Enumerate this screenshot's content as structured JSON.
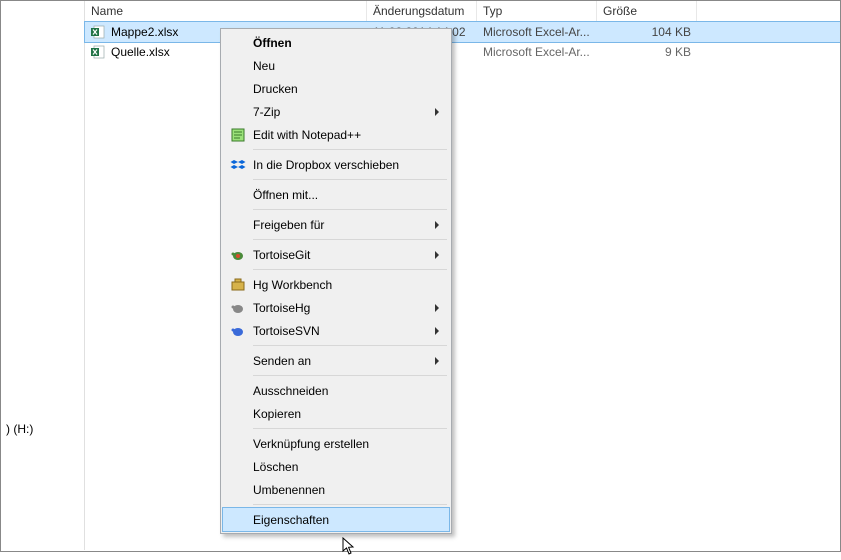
{
  "tree": {
    "drive_label": ") (H:)"
  },
  "columns": {
    "name": "Name",
    "date": "Änderungsdatum",
    "type": "Typ",
    "size": "Größe"
  },
  "files": [
    {
      "name": "Mappe2.xlsx",
      "date": "11.02.2014 14:02",
      "type": "Microsoft Excel-Ar...",
      "size": "104 KB",
      "selected": true
    },
    {
      "name": "Quelle.xlsx",
      "date": "",
      "type": "Microsoft Excel-Ar...",
      "size": "9 KB",
      "selected": false
    }
  ],
  "menu": {
    "open": "Öffnen",
    "new": "Neu",
    "print": "Drucken",
    "sevenzip": "7-Zip",
    "npp": "Edit with Notepad++",
    "dropbox": "In die Dropbox verschieben",
    "openwith": "Öffnen mit...",
    "share": "Freigeben für",
    "tgit": "TortoiseGit",
    "hgwb": "Hg Workbench",
    "thg": "TortoiseHg",
    "tsvn": "TortoiseSVN",
    "sendto": "Senden an",
    "cut": "Ausschneiden",
    "copy": "Kopieren",
    "link": "Verknüpfung erstellen",
    "delete": "Löschen",
    "rename": "Umbenennen",
    "properties": "Eigenschaften"
  }
}
